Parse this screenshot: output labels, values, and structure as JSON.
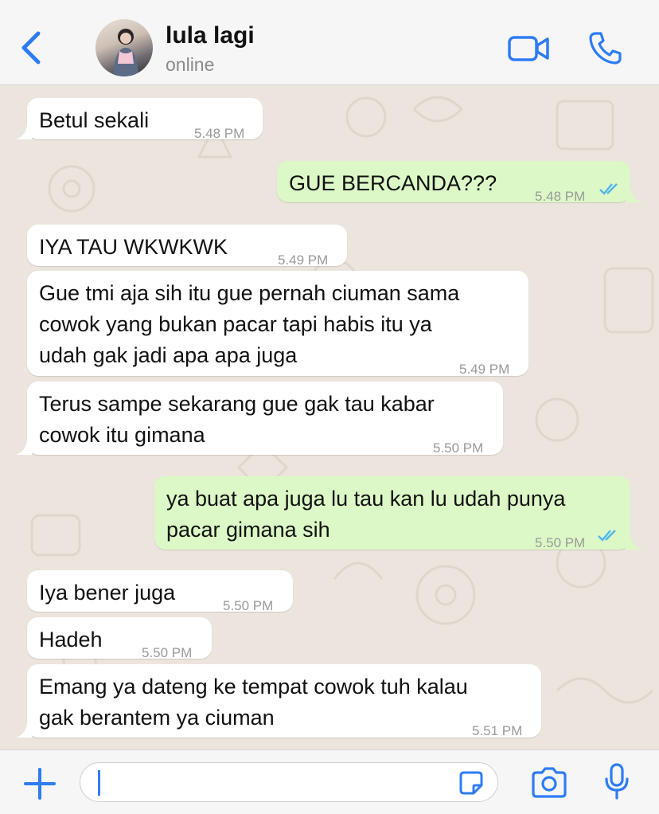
{
  "header": {
    "contact_name": "lula lagi",
    "status": "online"
  },
  "messages": [
    {
      "text_lines": [
        "Betul sekali"
      ],
      "time": "5.48 PM",
      "direction": "incoming"
    },
    {
      "text_lines": [
        "GUE BERCANDA???"
      ],
      "time": "5.48 PM",
      "direction": "outgoing",
      "read": true
    },
    {
      "text_lines": [
        "IYA TAU WKWKWK"
      ],
      "time": "5.49 PM",
      "direction": "incoming"
    },
    {
      "text_lines": [
        "Gue tmi aja sih itu gue pernah ciuman sama",
        "cowok yang bukan pacar tapi habis itu ya",
        "udah gak jadi apa apa juga"
      ],
      "time": "5.49 PM",
      "direction": "incoming"
    },
    {
      "text_lines": [
        "Terus sampe sekarang gue gak tau kabar",
        "cowok itu gimana"
      ],
      "time": "5.50 PM",
      "direction": "incoming"
    },
    {
      "text_lines": [
        "ya buat apa juga lu tau kan lu udah punya",
        "pacar gimana sih"
      ],
      "time": "5.50 PM",
      "direction": "outgoing",
      "read": true
    },
    {
      "text_lines": [
        "Iya bener juga"
      ],
      "time": "5.50 PM",
      "direction": "incoming"
    },
    {
      "text_lines": [
        "Hadeh"
      ],
      "time": "5.50 PM",
      "direction": "incoming"
    },
    {
      "text_lines": [
        "Emang ya dateng ke tempat cowok tuh kalau",
        "gak berantem ya ciuman"
      ],
      "time": "5.51 PM",
      "direction": "incoming"
    }
  ],
  "composer": {
    "text": ""
  },
  "colors": {
    "accent": "#2e7cf6",
    "incoming_bubble": "#ffffff",
    "outgoing_bubble": "#dcf8c6",
    "chat_background": "#ece5dd",
    "read_ticks": "#4fb6ec"
  },
  "icons": [
    "chevron-left-icon",
    "video-call-icon",
    "phone-icon",
    "plus-icon",
    "sticker-icon",
    "camera-icon",
    "microphone-icon",
    "double-check-icon"
  ]
}
